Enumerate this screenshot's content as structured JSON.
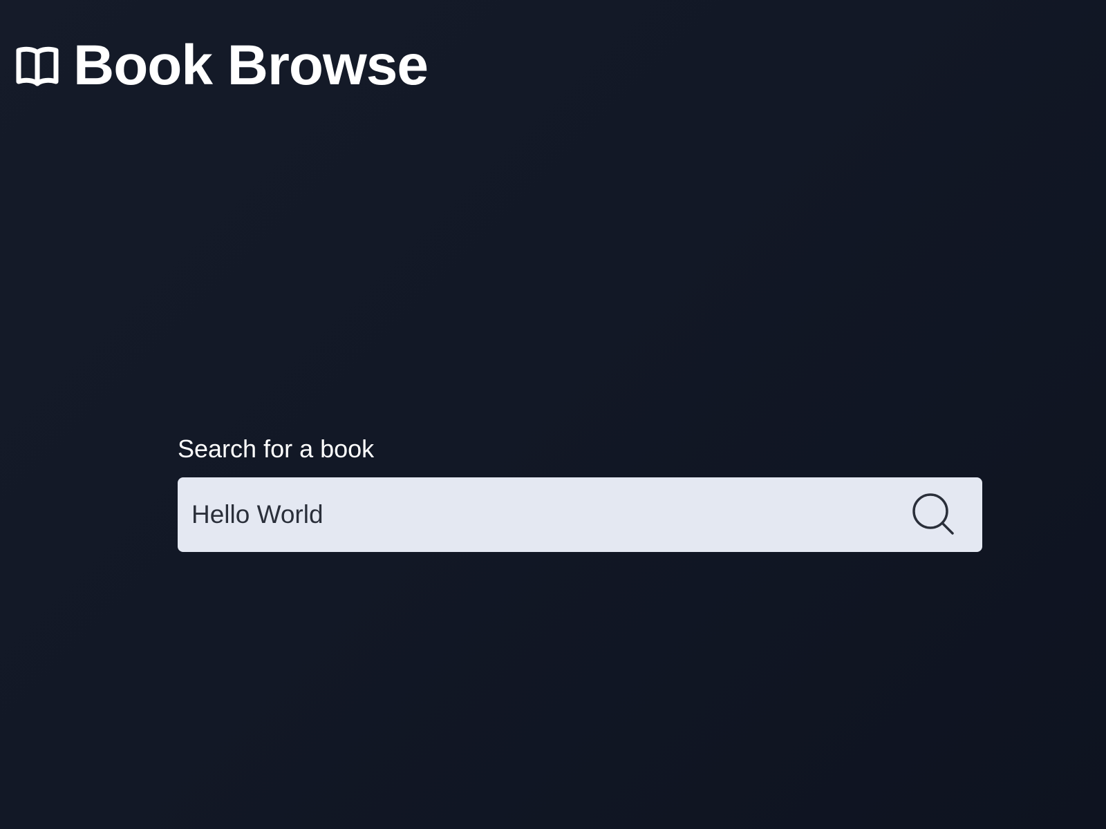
{
  "header": {
    "logo_icon": "open-book-icon",
    "title": "Book Browse"
  },
  "search": {
    "label": "Search for a book",
    "value": "Hello World",
    "button_icon": "search-icon"
  },
  "colors": {
    "background": "#121826",
    "input_background": "#e4e8f2",
    "text_primary": "#ffffff",
    "input_text": "#2a2f3a"
  }
}
